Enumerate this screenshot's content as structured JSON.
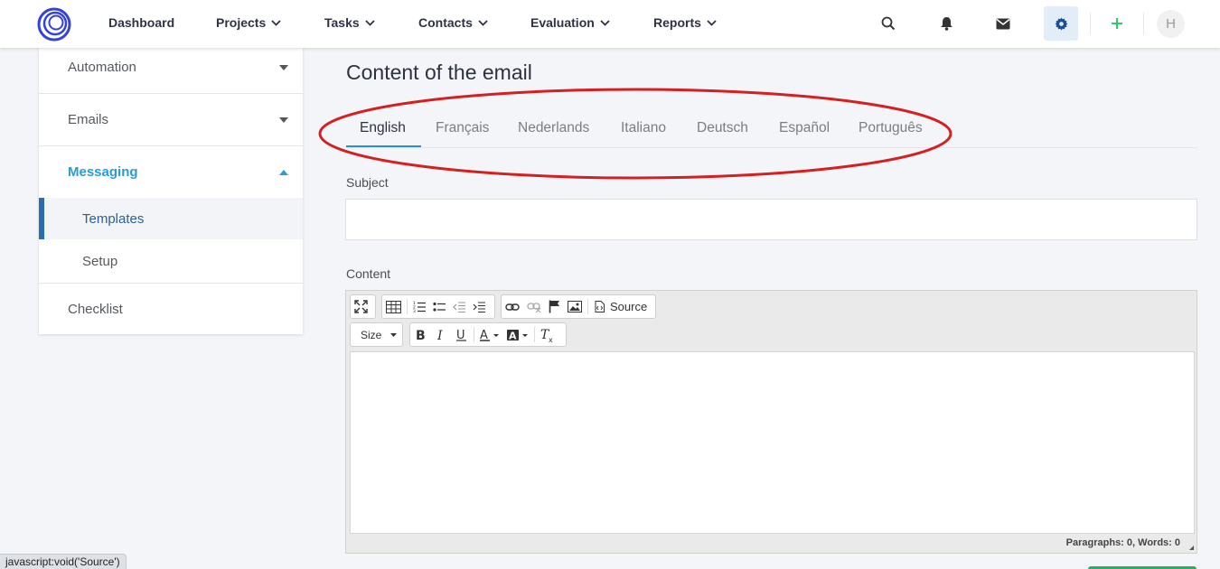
{
  "nav": {
    "items": [
      {
        "label": "Dashboard",
        "has_dropdown": false
      },
      {
        "label": "Projects",
        "has_dropdown": true
      },
      {
        "label": "Tasks",
        "has_dropdown": true
      },
      {
        "label": "Contacts",
        "has_dropdown": true
      },
      {
        "label": "Evaluation",
        "has_dropdown": true
      },
      {
        "label": "Reports",
        "has_dropdown": true
      }
    ],
    "icons": [
      "search-icon",
      "bell-icon",
      "envelope-icon",
      "gear-icon",
      "plus-icon"
    ],
    "avatar_initial": "H",
    "accent_color": "#3442d9",
    "plus_color": "#2ecc71"
  },
  "sidebar": {
    "items": [
      {
        "label": "Automation",
        "expanded": false
      },
      {
        "label": "Emails",
        "expanded": false
      },
      {
        "label": "Messaging",
        "expanded": true
      },
      {
        "label": "Checklist"
      }
    ],
    "sub_items": [
      {
        "label": "Templates",
        "active": true
      },
      {
        "label": "Setup",
        "active": false
      }
    ],
    "active_color": "#2a9bd6"
  },
  "main": {
    "title": "Content of the email",
    "tabs": [
      {
        "label": "English",
        "active": true
      },
      {
        "label": "Français"
      },
      {
        "label": "Nederlands"
      },
      {
        "label": "Italiano"
      },
      {
        "label": "Deutsch"
      },
      {
        "label": "Español"
      },
      {
        "label": "Português"
      }
    ],
    "subject_label": "Subject",
    "subject_value": "",
    "content_label": "Content"
  },
  "editor": {
    "toolbar_row1": [
      "maximize-icon",
      "table-icon",
      "numbered-list-icon",
      "bulleted-list-icon",
      "outdent-icon",
      "indent-icon",
      "link-icon",
      "unlink-icon",
      "anchor-flag-icon",
      "image-icon",
      "source-icon"
    ],
    "source_label": "Source",
    "size_label": "Size",
    "toolbar_row2": [
      "bold-icon",
      "italic-icon",
      "underline-icon",
      "text-color-icon",
      "background-color-icon",
      "remove-format-icon"
    ],
    "status": "Paragraphs: 0, Words: 0"
  },
  "browser_status": "javascript:void('Source')"
}
